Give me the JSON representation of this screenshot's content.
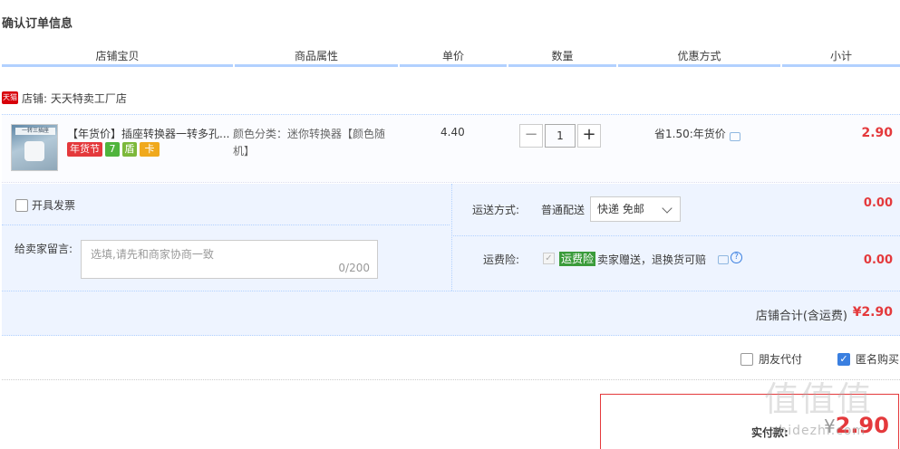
{
  "page": {
    "title": "确认订单信息"
  },
  "columns": [
    "店铺宝贝",
    "商品属性",
    "单价",
    "数量",
    "优惠方式",
    "小计"
  ],
  "store": {
    "badge": "天猫",
    "label": "店铺: 天天特卖工厂店"
  },
  "item": {
    "thumb_caption": "一转三插座",
    "title": "【年货价】插座转换器一转多孔...",
    "badge_nian": "年货节",
    "badge_7": "7",
    "badge_shield": "盾",
    "badge_card": "卡",
    "attr": "颜色分类：迷你转换器【颜色随机】",
    "price": "4.40",
    "qty_minus": "−",
    "qty_value": "1",
    "qty_plus": "+",
    "discount": "省1.50:年货价",
    "subtotal": "2.90"
  },
  "options": {
    "invoice_label": "开具发票",
    "message_label": "给卖家留言:",
    "message_placeholder": "选填,请先和商家协商一致",
    "message_count": "0/200",
    "shipping_label": "运送方式:",
    "shipping_type": "普通配送",
    "shipping_select": "快递 免邮",
    "shipping_fee": "0.00",
    "insurance_label": "运费险:",
    "insurance_badge": "运费险",
    "insurance_text": "卖家赠送，退换货可赔",
    "insurance_fee": "0.00",
    "help_glyph": "?"
  },
  "store_total": {
    "label": "店铺合计(含运费)",
    "value": "¥2.90"
  },
  "extras": {
    "friend_pay": "朋友代付",
    "anonymous": "匿名购买",
    "check_mark": "✓"
  },
  "payment": {
    "label": "实付款:",
    "currency": "¥",
    "value": "2.90"
  },
  "watermark": {
    "big": "值值值",
    "small": "zhidezhi.com"
  }
}
